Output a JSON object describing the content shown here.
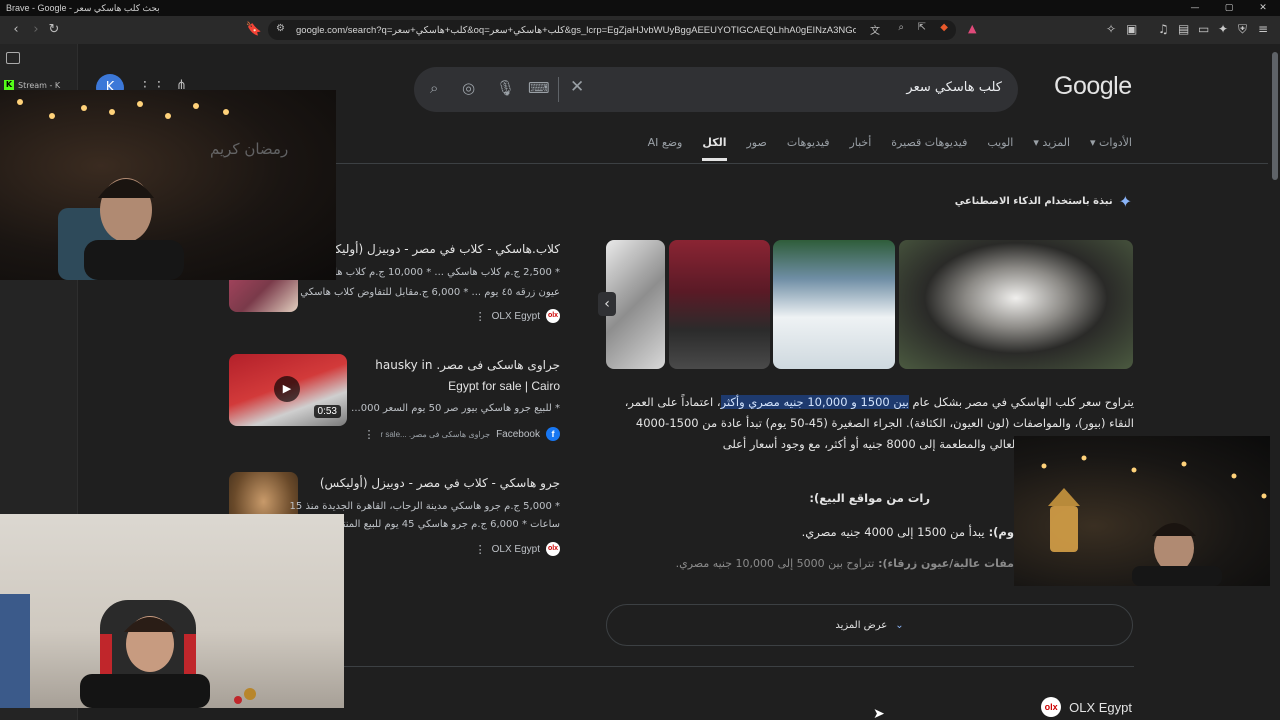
{
  "window": {
    "title": "Brave - Google - بحث كلب هاسكي سعر",
    "controls": [
      "—",
      "▢",
      "✕"
    ]
  },
  "toolbar": {
    "url": "google.com/search?q=كلب+هاسكي+سعر&oq=كلب+هاسكي+سعر&gs_lcrp=EgZjaHJvbWUyBggAEEUYOTIGCAEQLhhA0gEINzA3NGowajGo..."
  },
  "sidebar": {
    "stream_label": "Stream - K"
  },
  "google": {
    "logo": "Google",
    "query": "كلب هاسكي سعر",
    "avatar_letter": "K",
    "tabs": [
      {
        "label": "وضع AI"
      },
      {
        "label": "الكل"
      },
      {
        "label": "صور"
      },
      {
        "label": "فيديوهات"
      },
      {
        "label": "أخبار"
      },
      {
        "label": "فيديوهات قصيرة"
      },
      {
        "label": "الويب"
      },
      {
        "label": "المزيد ▾"
      },
      {
        "label": "الأدوات ▾"
      }
    ]
  },
  "ai_overview": {
    "heading": "نبذة باستخدام الذكاء الاصطناعي",
    "paragraph_pre": "يتراوح سعر كلب الهاسكي في مصر بشكل عام ",
    "paragraph_highlight": "بين 1500 و 10,000 جنيه مصري وأكثر",
    "paragraph_post": "، اعتماداً على العمر، النقاء (بيور)، والمواصفات (لون العيون، الكثافة). الجراء الصغيرة (45-50 يوم) تبدأ عادة من 1500-4000 جنيه، بينما تصل مستوى العالي والمطعمة إلى 8000 جنيه أو أكثر، مع وجود أسعار أعلى",
    "subheading": "رات من مواقع البيع):",
    "line1_bold": "وم): ",
    "line1_rest": "يبدأ من 1500 إلى 4000 جنيه مصري.",
    "line2_bold": "مفات عالية/عيون زرقاء): ",
    "line2_rest": "تتراوح بين 5000 إلى 10,000 جنيه مصري.",
    "show_more": "عرض المزيد",
    "bottom_source": "OLX Egypt"
  },
  "results": [
    {
      "title": "كلاب.هاسكي - كلاب في مصر - دوبيزل (أوليكس)",
      "snippet1": "* 2,500 ج.م كلاب هاسكي ... * 10,000 ج.م كلاب هاسكي",
      "snippet2": "عيون زرقه ٤٥ يوم ... * 6,000 ج.مقابل للتفاوض كلاب هاسكي",
      "source": "OLX Egypt"
    },
    {
      "title": "جراوى هاسكى فى مصر. hausky in",
      "title2": "Egypt for sale | Cairo",
      "snippet1": "* للبيع جرو هاسكي بيور صر 50 يوم السعر 000...",
      "source": "Facebook",
      "source_sub": "جراوى هاسكى فى مصر. ...r sale",
      "duration": "0:53"
    },
    {
      "title": "جرو هاسكي - كلاب في مصر - دوبيزل (أوليكس)",
      "snippet1": "* 5,000 ج.م جرو هاسكي مدينة الرحاب، القاهرة الجديدة منذ 15",
      "snippet2": "ساعات * 6,000 ج.م جرو هاسكي 45 يوم للبيع المنترة...",
      "source": "OLX Egypt"
    }
  ],
  "webcam": {
    "wall_text": "رمضان كريم"
  },
  "colors": {
    "background": "#1f1f1f",
    "search_bg": "#303134",
    "highlight": "#1e3a6e",
    "accent": "#8ab4f8"
  }
}
